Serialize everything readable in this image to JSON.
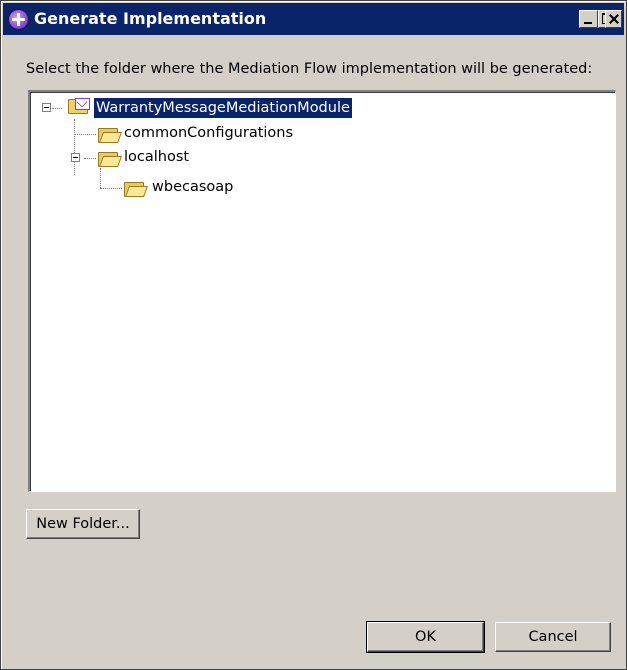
{
  "window": {
    "title": "Generate Implementation"
  },
  "prompt": "Select the folder where the Mediation Flow implementation will be generated:",
  "tree": {
    "root": "WarrantyMessageMediationModule",
    "items": [
      {
        "label": "commonConfigurations",
        "icon": "folder-icon"
      },
      {
        "label": "localhost",
        "icon": "folder-icon"
      },
      {
        "label": "wbecasoap",
        "icon": "folder-icon"
      }
    ]
  },
  "buttons": {
    "new_folder": "New Folder...",
    "ok": "OK",
    "cancel": "Cancel"
  },
  "colors": {
    "titlebar": "#0a246a",
    "selection": "#0a246a",
    "dialog_bg": "#d4d0c8"
  }
}
